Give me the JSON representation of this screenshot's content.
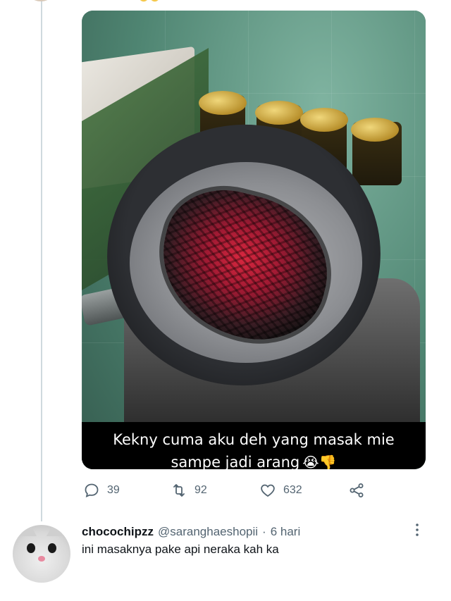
{
  "tweet": {
    "image_caption": {
      "line1": "Kekny cuma aku deh yang masak mie",
      "line2": "sampe jadi arang",
      "emojis": "😭👎"
    },
    "actions": {
      "reply_count": "39",
      "retweet_count": "92",
      "like_count": "632"
    },
    "icons": {
      "reply": "reply-icon",
      "retweet": "retweet-icon",
      "like": "heart-icon",
      "share": "share-icon"
    }
  },
  "reply": {
    "display_name": "chocochipzz",
    "handle": "@saranghaeshopii",
    "separator": "·",
    "time": "6 hari",
    "text": "ini masaknya pake api neraka kah ka"
  },
  "colors": {
    "secondary_text": "#536471",
    "primary_text": "#0f1419",
    "thread_line": "#cfd9de"
  }
}
